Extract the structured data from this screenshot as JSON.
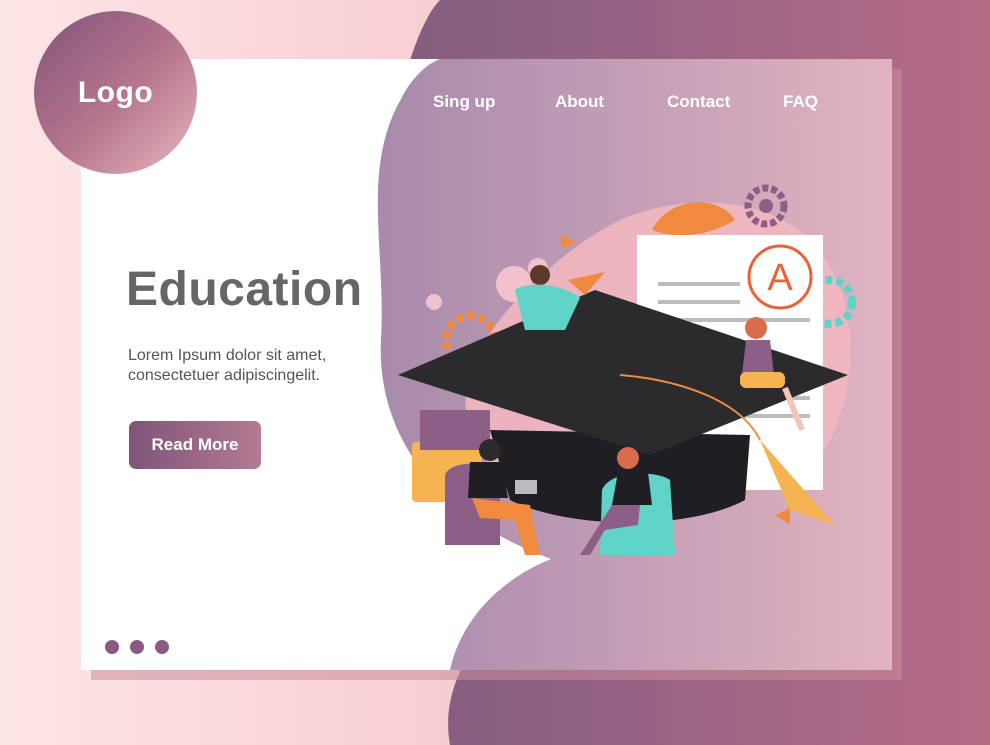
{
  "logo": {
    "text": "Logo"
  },
  "nav": {
    "items": [
      {
        "label": "Sing up"
      },
      {
        "label": "About"
      },
      {
        "label": "Contact"
      },
      {
        "label": "FAQ"
      }
    ]
  },
  "hero": {
    "title": "Education",
    "line1": "Lorem Ipsum dolor sit amet,",
    "line2": "consectetuer adipiscingelit.",
    "button_label": "Read More"
  },
  "pagination": {
    "count": 3
  },
  "certificate": {
    "grade": "A"
  },
  "colors": {
    "accent_purple": "#7f5478",
    "accent_pink": "#e8a3ad",
    "orange": "#e8623a",
    "teal": "#5fd3c8",
    "cap": "#2b2a2d"
  }
}
